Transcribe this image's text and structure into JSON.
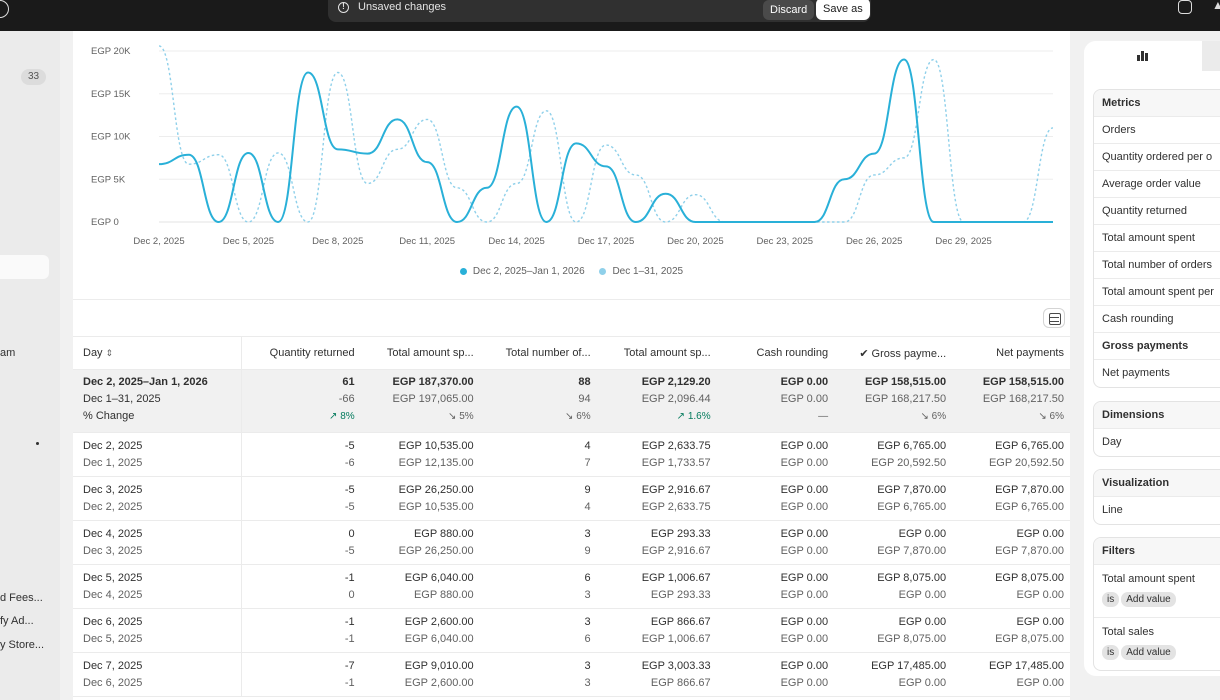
{
  "topbar": {
    "unsaved_label": "Unsaved changes",
    "discard_label": "Discard",
    "save_label": "Save as"
  },
  "sidebar": {
    "badge_count": "33",
    "items": [
      {
        "label": "am"
      },
      {
        "label": "d Fees..."
      },
      {
        "label": "fy Ad..."
      },
      {
        "label": "y Store..."
      }
    ]
  },
  "chart_data": {
    "type": "line",
    "x": [
      "Dec 2",
      "Dec 3",
      "Dec 4",
      "Dec 5",
      "Dec 6",
      "Dec 7",
      "Dec 8",
      "Dec 9",
      "Dec 10",
      "Dec 11",
      "Dec 12",
      "Dec 13",
      "Dec 14",
      "Dec 15",
      "Dec 16",
      "Dec 17",
      "Dec 18",
      "Dec 19",
      "Dec 20",
      "Dec 21",
      "Dec 22",
      "Dec 23",
      "Dec 24",
      "Dec 25",
      "Dec 26",
      "Dec 27",
      "Dec 28",
      "Dec 29",
      "Dec 30",
      "Dec 31",
      "Jan 1"
    ],
    "x_tick_labels": [
      "Dec 2, 2025",
      "Dec 5, 2025",
      "Dec 8, 2025",
      "Dec 11, 2025",
      "Dec 14, 2025",
      "Dec 17, 2025",
      "Dec 20, 2025",
      "Dec 23, 2025",
      "Dec 26, 2025",
      "Dec 29, 2025"
    ],
    "y_tick_labels": [
      "EGP 0",
      "EGP 5K",
      "EGP 10K",
      "EGP 15K",
      "EGP 20K"
    ],
    "ylim": [
      0,
      20000
    ],
    "grid": true,
    "legend_position": "bottom",
    "series": [
      {
        "name": "Dec 2, 2025–Jan 1, 2026",
        "color": "#29b0d8",
        "style": "solid",
        "values": [
          6765,
          7870,
          0,
          8075,
          0,
          17485,
          8500,
          8000,
          12000,
          7000,
          0,
          4000,
          13500,
          0,
          9200,
          6500,
          0,
          3300,
          0,
          0,
          0,
          0,
          0,
          5000,
          8000,
          19000,
          0,
          0,
          0,
          0,
          0
        ]
      },
      {
        "name": "Dec 1–31, 2025",
        "color": "#8fd0ea",
        "style": "dashed",
        "values": [
          20592.5,
          6765,
          7870,
          0,
          8075,
          0,
          17485,
          4500,
          8500,
          12000,
          4000,
          0,
          4500,
          13000,
          0,
          9000,
          5500,
          0,
          3200,
          0,
          0,
          0,
          0,
          0,
          5500,
          7500,
          19000,
          0,
          0,
          0,
          11000
        ]
      }
    ]
  },
  "table": {
    "columns": [
      "Day",
      "Quantity returned",
      "Total amount sp...",
      "Total number of...",
      "Total amount sp...",
      "Cash rounding",
      "Gross payme...",
      "Net payments"
    ],
    "summary": {
      "period": [
        "Dec 2, 2025–Jan 1, 2026",
        "61",
        "EGP 187,370.00",
        "88",
        "EGP 2,129.20",
        "EGP 0.00",
        "EGP 158,515.00",
        "EGP 158,515.00"
      ],
      "previous": [
        "Dec 1–31, 2025",
        "-66",
        "EGP 197,065.00",
        "94",
        "EGP 2,096.44",
        "EGP 0.00",
        "EGP 168,217.50",
        "EGP 168,217.50"
      ],
      "change_label": "% Change",
      "changes": [
        {
          "text": "↗ 8%",
          "up": true
        },
        {
          "text": "↘ 5%",
          "up": false
        },
        {
          "text": "↘ 6%",
          "up": false
        },
        {
          "text": "↗ 1.6%",
          "up": true
        },
        {
          "text": "—",
          "up": false
        },
        {
          "text": "↘ 6%",
          "up": false
        },
        {
          "text": "↘ 6%",
          "up": false
        }
      ]
    },
    "rows": [
      {
        "a": [
          "Dec 2, 2025",
          "-5",
          "EGP 10,535.00",
          "4",
          "EGP 2,633.75",
          "EGP 0.00",
          "EGP 6,765.00",
          "EGP 6,765.00"
        ],
        "b": [
          "Dec 1, 2025",
          "-6",
          "EGP 12,135.00",
          "7",
          "EGP 1,733.57",
          "EGP 0.00",
          "EGP 20,592.50",
          "EGP 20,592.50"
        ]
      },
      {
        "a": [
          "Dec 3, 2025",
          "-5",
          "EGP 26,250.00",
          "9",
          "EGP 2,916.67",
          "EGP 0.00",
          "EGP 7,870.00",
          "EGP 7,870.00"
        ],
        "b": [
          "Dec 2, 2025",
          "-5",
          "EGP 10,535.00",
          "4",
          "EGP 2,633.75",
          "EGP 0.00",
          "EGP 6,765.00",
          "EGP 6,765.00"
        ]
      },
      {
        "a": [
          "Dec 4, 2025",
          "0",
          "EGP 880.00",
          "3",
          "EGP 293.33",
          "EGP 0.00",
          "EGP 0.00",
          "EGP 0.00"
        ],
        "b": [
          "Dec 3, 2025",
          "-5",
          "EGP 26,250.00",
          "9",
          "EGP 2,916.67",
          "EGP 0.00",
          "EGP 7,870.00",
          "EGP 7,870.00"
        ]
      },
      {
        "a": [
          "Dec 5, 2025",
          "-1",
          "EGP 6,040.00",
          "6",
          "EGP 1,006.67",
          "EGP 0.00",
          "EGP 8,075.00",
          "EGP 8,075.00"
        ],
        "b": [
          "Dec 4, 2025",
          "0",
          "EGP 880.00",
          "3",
          "EGP 293.33",
          "EGP 0.00",
          "EGP 0.00",
          "EGP 0.00"
        ]
      },
      {
        "a": [
          "Dec 6, 2025",
          "-1",
          "EGP 2,600.00",
          "3",
          "EGP 866.67",
          "EGP 0.00",
          "EGP 0.00",
          "EGP 0.00"
        ],
        "b": [
          "Dec 5, 2025",
          "-1",
          "EGP 6,040.00",
          "6",
          "EGP 1,006.67",
          "EGP 0.00",
          "EGP 8,075.00",
          "EGP 8,075.00"
        ]
      },
      {
        "a": [
          "Dec 7, 2025",
          "-7",
          "EGP 9,010.00",
          "3",
          "EGP 3,003.33",
          "EGP 0.00",
          "EGP 17,485.00",
          "EGP 17,485.00"
        ],
        "b": [
          "Dec 6, 2025",
          "-1",
          "EGP 2,600.00",
          "3",
          "EGP 866.67",
          "EGP 0.00",
          "EGP 0.00",
          "EGP 0.00"
        ]
      }
    ]
  },
  "panel": {
    "metrics": {
      "title": "Metrics",
      "items": [
        {
          "label": "Orders",
          "bold": false
        },
        {
          "label": "Quantity ordered per o",
          "bold": false
        },
        {
          "label": "Average order value",
          "bold": false
        },
        {
          "label": "Quantity returned",
          "bold": false
        },
        {
          "label": "Total amount spent",
          "bold": false
        },
        {
          "label": "Total number of orders",
          "bold": false
        },
        {
          "label": "Total amount spent per",
          "bold": false
        },
        {
          "label": "Cash rounding",
          "bold": false
        },
        {
          "label": "Gross payments",
          "bold": true
        },
        {
          "label": "Net payments",
          "bold": false
        }
      ]
    },
    "dimensions": {
      "title": "Dimensions",
      "items": [
        "Day"
      ]
    },
    "visualization": {
      "title": "Visualization",
      "value": "Line"
    },
    "filters": {
      "title": "Filters",
      "items": [
        {
          "name": "Total amount spent",
          "op": "is",
          "action": "Add value"
        },
        {
          "name": "Total sales",
          "op": "is",
          "action": "Add value"
        }
      ]
    }
  }
}
